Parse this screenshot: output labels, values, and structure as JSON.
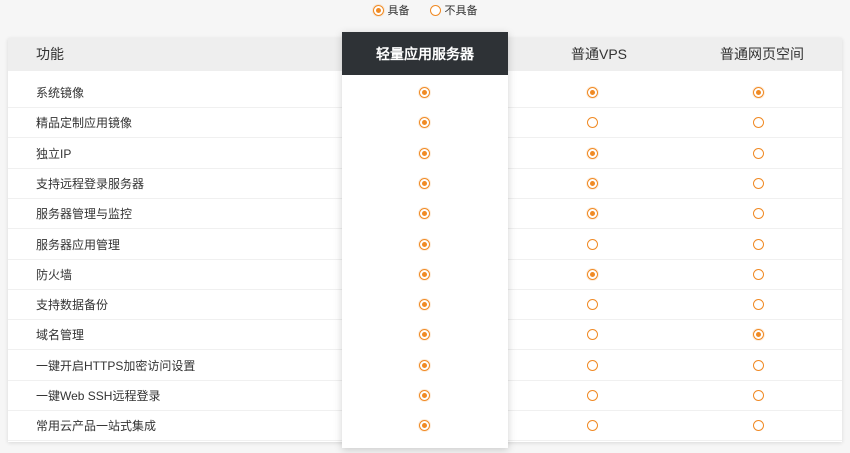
{
  "legend": {
    "has": "具备",
    "not_has": "不具备"
  },
  "colors": {
    "accent": "#f08a24",
    "highlight_header_bg": "#2e3236",
    "header_bg": "#eeeeee"
  },
  "table": {
    "feature_header": "功能",
    "columns": [
      "轻量应用服务器",
      "普通VPS",
      "普通网页空间"
    ],
    "rows": [
      {
        "label": "系统镜像",
        "values": [
          true,
          true,
          true
        ]
      },
      {
        "label": "精品定制应用镜像",
        "values": [
          true,
          false,
          false
        ]
      },
      {
        "label": "独立IP",
        "values": [
          true,
          true,
          false
        ]
      },
      {
        "label": "支持远程登录服务器",
        "values": [
          true,
          true,
          false
        ]
      },
      {
        "label": "服务器管理与监控",
        "values": [
          true,
          true,
          false
        ]
      },
      {
        "label": "服务器应用管理",
        "values": [
          true,
          false,
          false
        ]
      },
      {
        "label": "防火墙",
        "values": [
          true,
          true,
          false
        ]
      },
      {
        "label": "支持数据备份",
        "values": [
          true,
          false,
          false
        ]
      },
      {
        "label": "域名管理",
        "values": [
          true,
          false,
          true
        ]
      },
      {
        "label": "一键开启HTTPS加密访问设置",
        "values": [
          true,
          false,
          false
        ]
      },
      {
        "label": "一键Web SSH远程登录",
        "values": [
          true,
          false,
          false
        ]
      },
      {
        "label": "常用云产品一站式集成",
        "values": [
          true,
          false,
          false
        ]
      }
    ]
  }
}
